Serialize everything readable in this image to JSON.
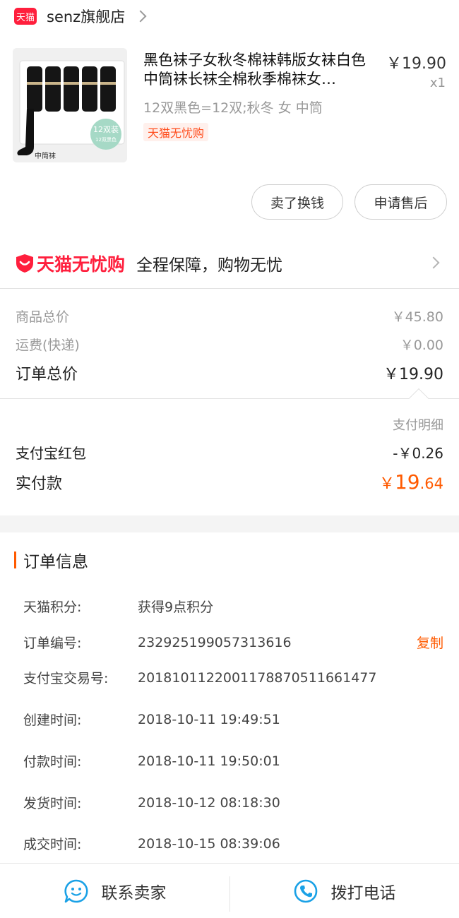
{
  "shop": {
    "badge": "天猫",
    "name": "senz旗舰店"
  },
  "product": {
    "thumb": {
      "box_label": "12双装",
      "box_sub": "12双黑色",
      "caption": "中筒袜"
    },
    "title": "黑色袜子女秋冬棉袜韩版女袜白色中筒袜长袜全棉秋季棉袜女…",
    "price": "￥19.90",
    "qty": "x1",
    "sku": "12双黑色=12双;秋冬 女 中筒",
    "tag": "天猫无忧购"
  },
  "actions": {
    "sell_label": "卖了换钱",
    "after_sales_label": "申请售后"
  },
  "guarantee": {
    "brand": "天猫无忧购",
    "text": "全程保障，购物无忧"
  },
  "pricing": {
    "goods_total_label": "商品总价",
    "goods_total": "￥45.80",
    "shipping_label": "运费(快递)",
    "shipping": "￥0.00",
    "order_total_label": "订单总价",
    "order_total": "￥19.90",
    "pay_detail_label": "支付明细",
    "redpacket_label": "支付宝红包",
    "redpacket": "-￥0.26",
    "actual_label": "实付款",
    "actual_symbol": "￥",
    "actual_int": "19",
    "actual_dec": ".64"
  },
  "order_info": {
    "title": "订单信息",
    "copy_label": "复制",
    "rows": [
      {
        "key": "天猫积分:",
        "value": "获得9点积分"
      },
      {
        "key": "订单编号:",
        "value": "232925199057313616"
      },
      {
        "key": "支付宝交易号:",
        "value": "20181011220011788705116614​77"
      },
      {
        "key": "创建时间:",
        "value": "2018-10-11 19:49:51"
      },
      {
        "key": "付款时间:",
        "value": "2018-10-11 19:50:01"
      },
      {
        "key": "发货时间:",
        "value": "2018-10-12 08:18:30"
      },
      {
        "key": "成交时间:",
        "value": "2018-10-15 08:39:06"
      }
    ]
  },
  "bottom_bar": {
    "contact_label": "联系卖家",
    "call_label": "拨打电话"
  },
  "colors": {
    "tmall_red": "#ff1f3d",
    "accent_orange": "#ff5a00",
    "muted_text": "#999999",
    "icon_blue": "#1aa1e6"
  }
}
